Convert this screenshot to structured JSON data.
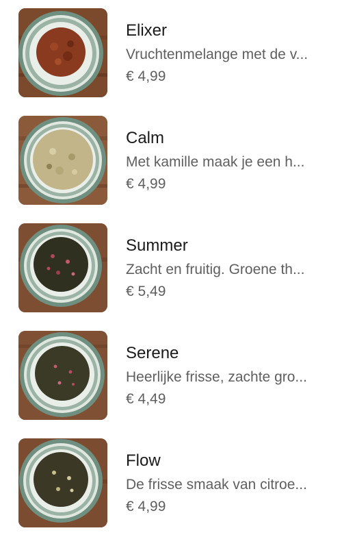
{
  "products": [
    {
      "name": "Elixer",
      "description": "Vruchtenmelange met de v...",
      "price": "€ 4,99",
      "image_icon": "tea-leaves-image",
      "tea_color": "#8a3a1e"
    },
    {
      "name": "Calm",
      "description": "Met kamille maak je een h...",
      "price": "€ 4,99",
      "image_icon": "tea-leaves-image",
      "tea_color": "#c2b58a"
    },
    {
      "name": "Summer",
      "description": "Zacht en fruitig. Groene th...",
      "price": "€ 5,49",
      "image_icon": "tea-leaves-image",
      "tea_color": "#2f3020"
    },
    {
      "name": "Serene",
      "description": "Heerlijke frisse, zachte gro...",
      "price": "€ 4,49",
      "image_icon": "tea-leaves-image",
      "tea_color": "#3a3a26"
    },
    {
      "name": "Flow",
      "description": "De frisse smaak van citroe...",
      "price": "€ 4,99",
      "image_icon": "tea-leaves-image",
      "tea_color": "#3b3826"
    }
  ]
}
